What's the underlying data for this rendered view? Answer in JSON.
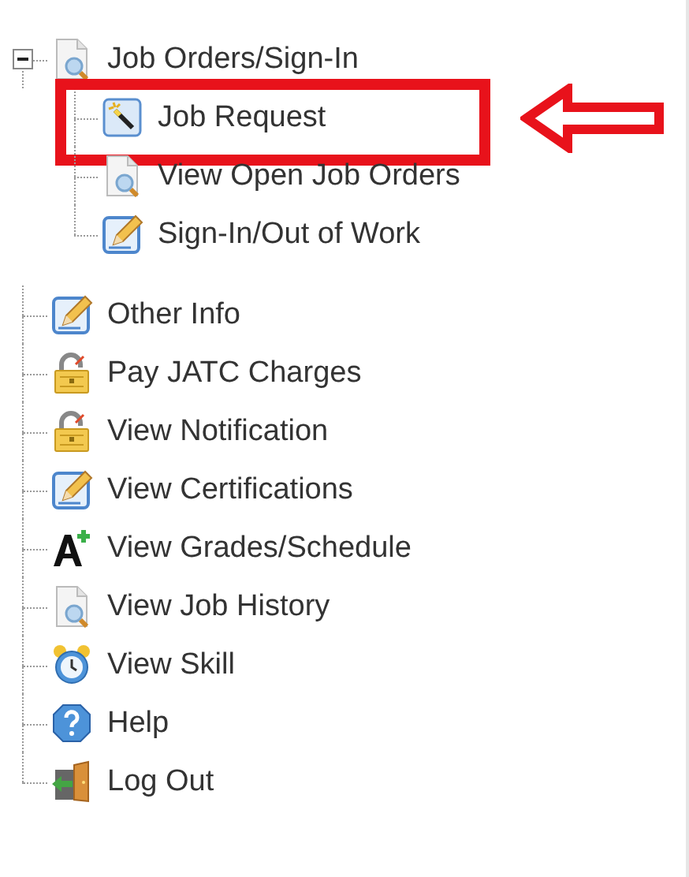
{
  "tree": [
    {
      "label": "Job Orders/Sign-In",
      "kind": "document-search",
      "expanded": true,
      "children": [
        {
          "label": "Job Request",
          "kind": "wand",
          "highlighted": true
        },
        {
          "label": "View Open Job Orders",
          "kind": "document-search",
          "highlighted": false
        },
        {
          "label": "Sign-In/Out of Work",
          "kind": "pencil",
          "highlighted": false
        }
      ]
    },
    {
      "label": "Other Info",
      "kind": "pencil"
    },
    {
      "label": "Pay JATC Charges",
      "kind": "lock"
    },
    {
      "label": "View Notification",
      "kind": "lock"
    },
    {
      "label": "View Certifications",
      "kind": "pencil"
    },
    {
      "label": "View Grades/Schedule",
      "kind": "grade"
    },
    {
      "label": "View Job History",
      "kind": "document-search"
    },
    {
      "label": "View Skill",
      "kind": "clock"
    },
    {
      "label": "Help",
      "kind": "help"
    },
    {
      "label": "Log Out",
      "kind": "exit"
    }
  ]
}
